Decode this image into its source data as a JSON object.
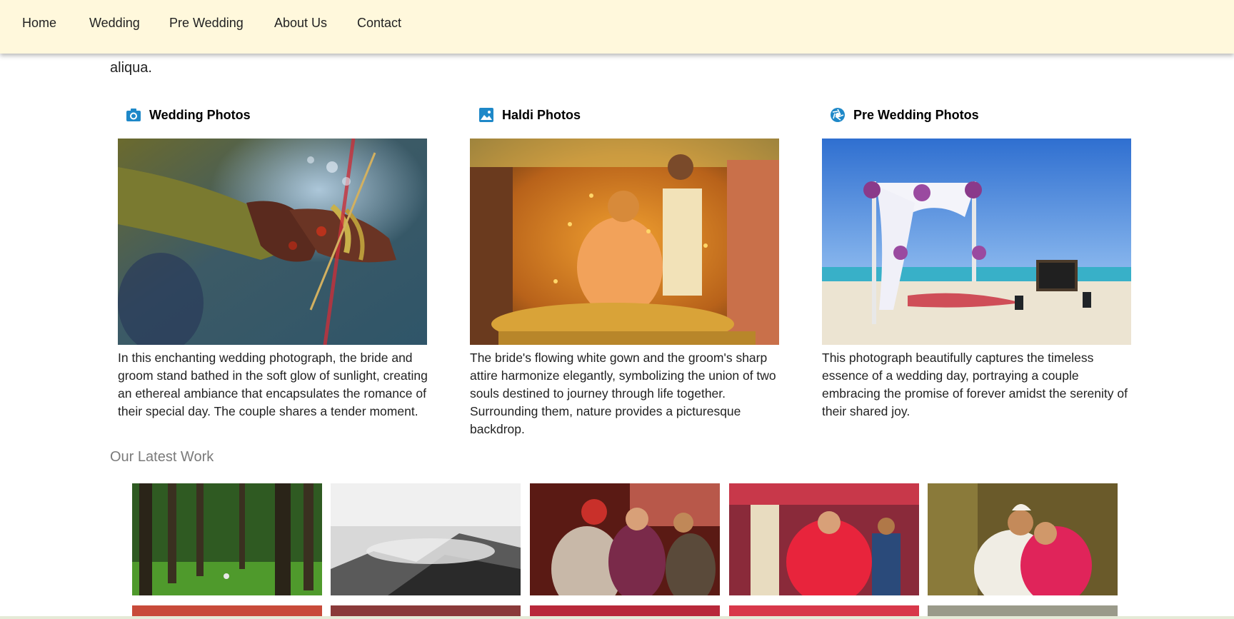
{
  "nav": {
    "items": [
      {
        "label": "Home"
      },
      {
        "label": "Wedding"
      },
      {
        "label": "Pre Wedding"
      },
      {
        "label": "About Us"
      },
      {
        "label": "Contact"
      }
    ]
  },
  "intro": {
    "tail_text": "aliqua."
  },
  "cards": [
    {
      "icon": "camera-icon",
      "title": "Wedding Photos",
      "photo": "photo-henna-hands",
      "text": "In this enchanting wedding photograph, the bride and groom stand bathed in the soft glow of sunlight, creating an ethereal ambiance that encapsulates the romance of their special day. The couple shares a tender moment."
    },
    {
      "icon": "image-icon",
      "title": "Haldi Photos",
      "photo": "photo-haldi-celebration",
      "text": "The bride's flowing white gown and the groom's sharp attire harmonize elegantly, symbolizing the union of two souls destined to journey through life together. Surrounding them, nature provides a picturesque backdrop."
    },
    {
      "icon": "aperture-icon",
      "title": "Pre Wedding Photos",
      "photo": "photo-beach-arch",
      "text": "This photograph beautifully captures the timeless essence of a wedding day, portraying a couple embracing the promise of forever amidst the serenity of their shared joy."
    }
  ],
  "latest_work": {
    "title": "Our Latest Work",
    "photos": [
      "photo-pine-forest",
      "photo-misty-mountains",
      "photo-wedding-dance",
      "photo-bride-celebration",
      "photo-couple-embrace"
    ]
  },
  "colors": {
    "navbar_bg": "#fff8dc",
    "icon_blue": "#1e88c8",
    "section_title": "#7a7a7a"
  }
}
